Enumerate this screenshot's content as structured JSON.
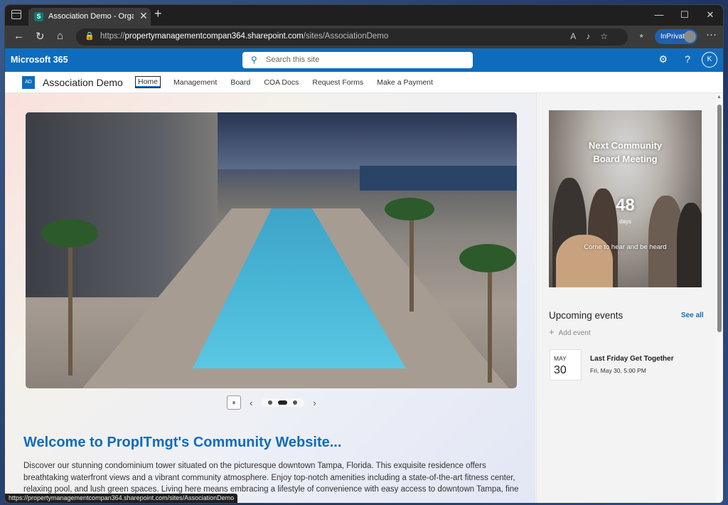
{
  "browser": {
    "tab_title": "Association Demo - Organization",
    "tab_close": "✕",
    "new_tab": "+",
    "window_controls": {
      "minimize": "—",
      "maximize": "☐",
      "close": "✕"
    },
    "url_prefix": "https://",
    "url_host": "propertymanagementcompan364.sharepoint.com",
    "url_path": "/sites/AssociationDemo",
    "inprivate_label": "InPrivate",
    "nav": {
      "back": "←",
      "refresh": "↻",
      "home": "⌂",
      "lock": "🔒",
      "more": "···"
    },
    "url_icons": "A♪☆",
    "favorites_icon": "⭒",
    "status_url": "https://propertymanagementcompan364.sharepoint.com/sites/AssociationDemo"
  },
  "suitebar": {
    "app_name": "Microsoft 365",
    "search_placeholder": "Search this site",
    "settings_icon": "⚙",
    "help_icon": "?",
    "user_initial": "K"
  },
  "site": {
    "logo_initials": "AD",
    "title": "Association Demo",
    "nav_items": [
      {
        "label": "Home",
        "active": true
      },
      {
        "label": "Management"
      },
      {
        "label": "Board"
      },
      {
        "label": "COA Docs"
      },
      {
        "label": "Request Forms"
      },
      {
        "label": "Make a Payment"
      }
    ]
  },
  "hero": {
    "pause_icon": "⏸",
    "prev_icon": "‹",
    "next_icon": "›",
    "slide_count": 3,
    "active_slide": 2
  },
  "welcome": {
    "title": "Welcome to PropITmgt's Community Website...",
    "body": "Discover our stunning condominium tower situated on the picturesque downtown Tampa, Florida. This exquisite residence offers breathtaking waterfront views and a vibrant community atmosphere. Enjoy top-notch amenities including a state-of-the-art fitness center, relaxing pool, and lush green spaces. Living here means embracing a lifestyle of convenience with easy access to downtown Tampa, fine dining, and f island living."
  },
  "countdown": {
    "title_line1": "Next Community",
    "title_line2": "Board Meeting",
    "number": "48",
    "unit": "days",
    "caption": "Come to hear and be heard"
  },
  "events": {
    "heading": "Upcoming events",
    "see_all": "See all",
    "add_event": "Add event",
    "add_icon": "+",
    "items": [
      {
        "month": "MAY",
        "day": "30",
        "title": "Last Friday Get Together",
        "time": "Fri, May 30, 5:00 PM"
      }
    ]
  },
  "colors": {
    "accent": "#0f6cbd",
    "tab_fav": "#0e7a74",
    "inprivate": "#1f5fb0"
  }
}
